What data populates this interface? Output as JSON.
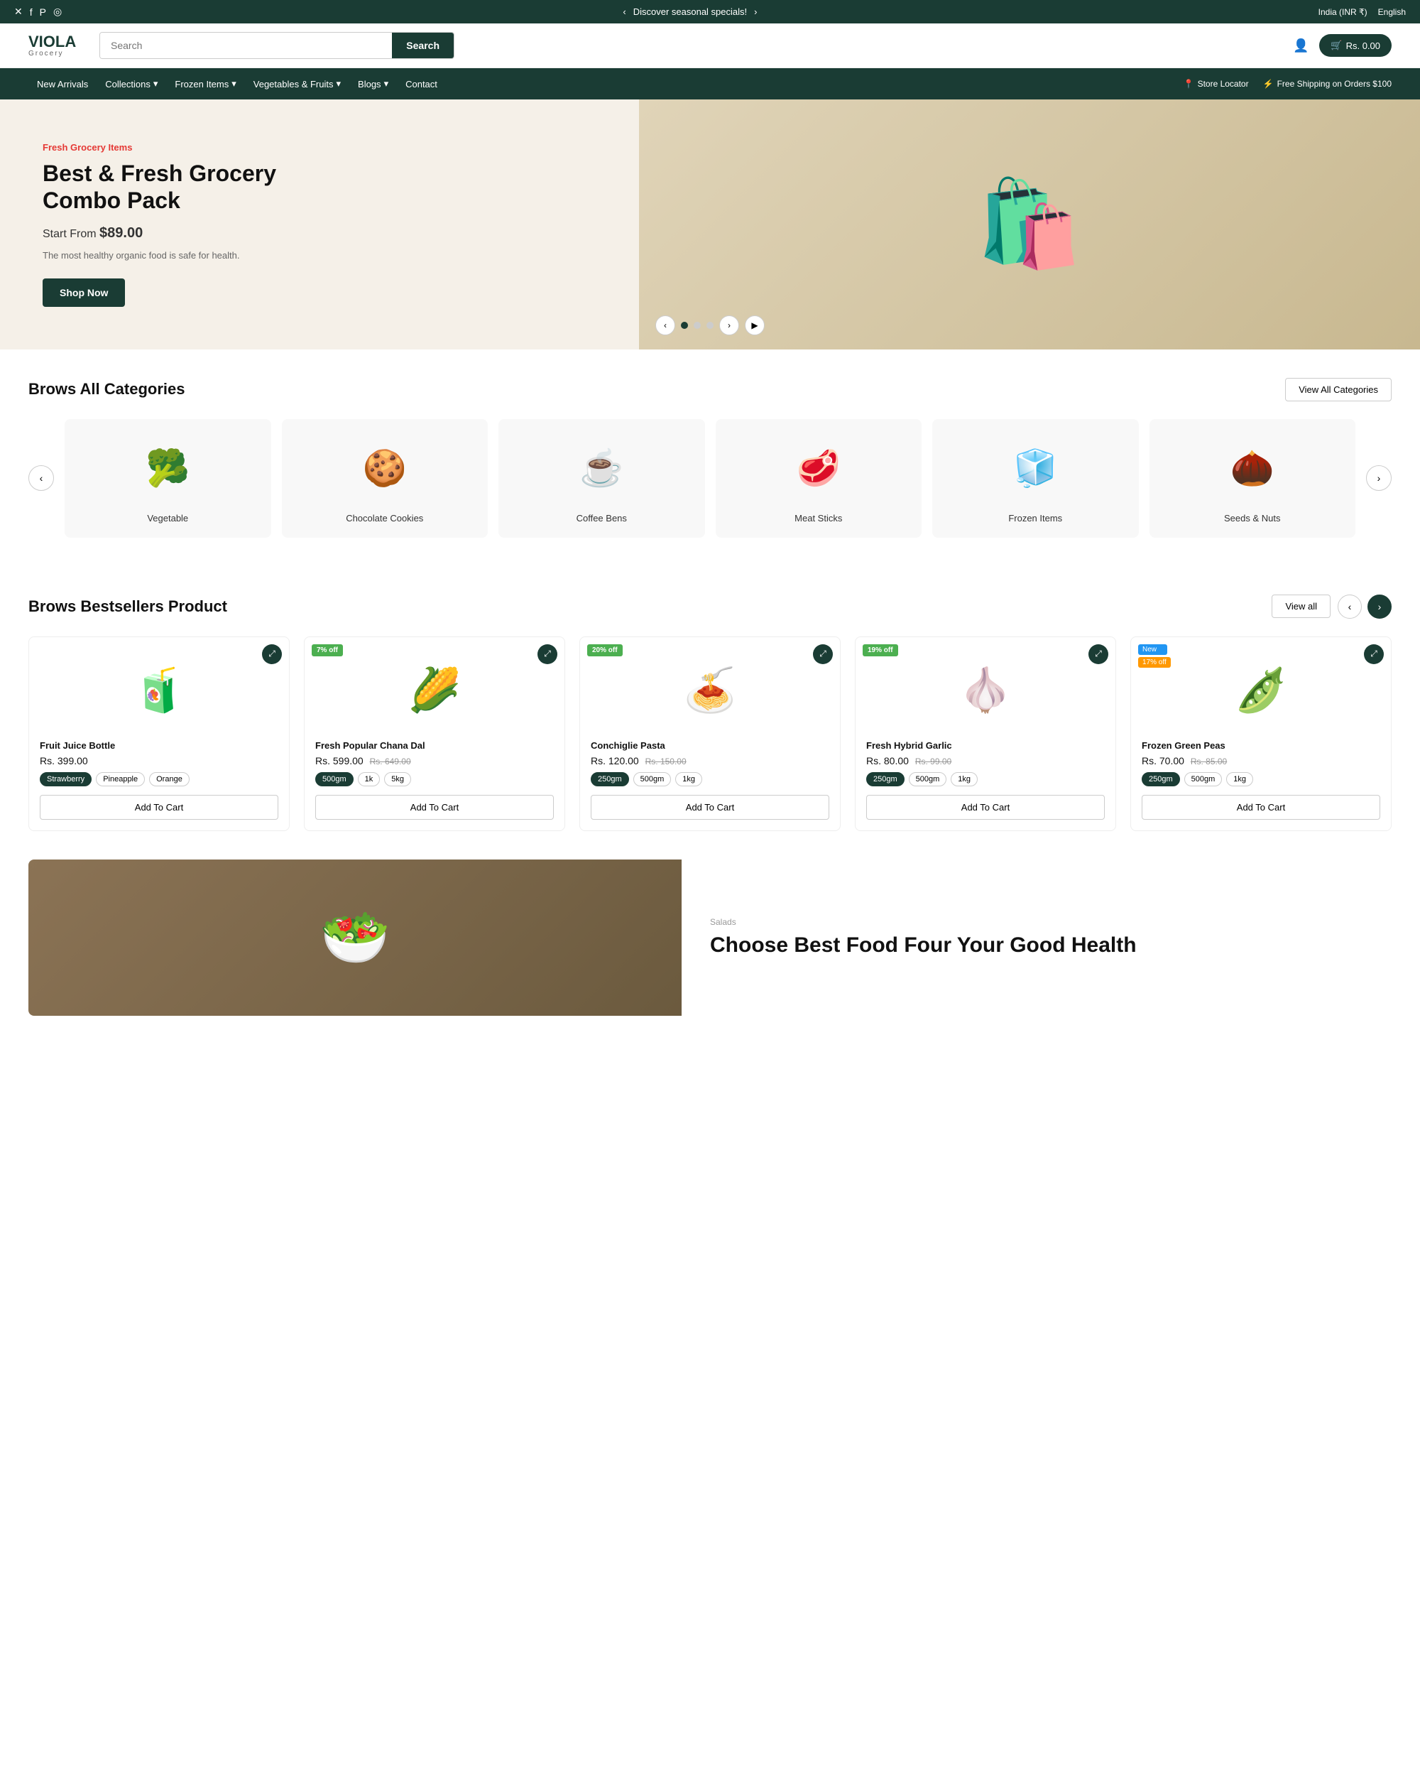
{
  "announcement": {
    "message": "Discover seasonal specials!",
    "left_arrow": "‹",
    "right_arrow": "›",
    "region": "India (INR ₹)",
    "language": "English",
    "social_icons": [
      "✕",
      "f",
      "P",
      "◎"
    ]
  },
  "header": {
    "logo_text": "VIOLA",
    "logo_sub": "Grocery",
    "search_placeholder": "Search",
    "search_button": "Search",
    "cart_label": "Rs. 0.00"
  },
  "nav": {
    "items": [
      {
        "label": "New Arrivals",
        "has_dropdown": false
      },
      {
        "label": "Collections",
        "has_dropdown": true
      },
      {
        "label": "Frozen Items",
        "has_dropdown": true
      },
      {
        "label": "Vegetables & Fruits",
        "has_dropdown": true
      },
      {
        "label": "Blogs",
        "has_dropdown": true
      },
      {
        "label": "Contact",
        "has_dropdown": false
      }
    ],
    "right_items": [
      {
        "label": "Store Locator",
        "icon": "📍"
      },
      {
        "label": "Free Shipping on Orders $100",
        "icon": "⚡"
      }
    ]
  },
  "hero": {
    "tag": "Fresh Grocery Items",
    "title": "Best & Fresh Grocery Combo Pack",
    "price_label": "Start From",
    "price": "$89.00",
    "description": "The most healthy organic food is safe for health.",
    "button_label": "Shop Now",
    "dots": [
      true,
      false,
      false
    ],
    "prev_arrow": "‹",
    "next_arrow": "›",
    "play_icon": "▶"
  },
  "categories_section": {
    "title": "Brows All Categories",
    "view_all_label": "View All Categories",
    "prev_arrow": "‹",
    "next_arrow": "›",
    "items": [
      {
        "name": "Vegetable",
        "emoji": "🥦"
      },
      {
        "name": "Chocolate Cookies",
        "emoji": "🍪"
      },
      {
        "name": "Coffee Bens",
        "emoji": "☕"
      },
      {
        "name": "Meat Sticks",
        "emoji": "🥩"
      },
      {
        "name": "Frozen Items",
        "emoji": "🧊"
      },
      {
        "name": "Seeds & Nuts",
        "emoji": "🌰"
      }
    ]
  },
  "bestsellers_section": {
    "title": "Brows Bestsellers Product",
    "view_all_label": "View all",
    "prev_arrow": "‹",
    "next_arrow": "›",
    "products": [
      {
        "name": "Fruit Juice Bottle",
        "price": "Rs. 399.00",
        "old_price": null,
        "badge": null,
        "badge_type": null,
        "emoji": "🧃",
        "variants": [
          {
            "label": "Strawberry",
            "active": true
          },
          {
            "label": "Pineapple",
            "active": false
          },
          {
            "label": "Orange",
            "active": false
          }
        ],
        "add_to_cart": "Add To Cart"
      },
      {
        "name": "Fresh Popular Chana Dal",
        "price": "Rs. 599.00",
        "old_price": "Rs. 649.00",
        "badge": "7% off",
        "badge_type": "sale",
        "emoji": "🌽",
        "variants": [
          {
            "label": "500gm",
            "active": true
          },
          {
            "label": "1k",
            "active": false
          },
          {
            "label": "5kg",
            "active": false
          }
        ],
        "add_to_cart": "Add To Cart"
      },
      {
        "name": "Conchiglie Pasta",
        "price": "Rs. 120.00",
        "old_price": "Rs. 150.00",
        "badge": "20% off",
        "badge_type": "sale",
        "emoji": "🍝",
        "variants": [
          {
            "label": "250gm",
            "active": true
          },
          {
            "label": "500gm",
            "active": false
          },
          {
            "label": "1kg",
            "active": false
          }
        ],
        "add_to_cart": "Add To Cart"
      },
      {
        "name": "Fresh Hybrid Garlic",
        "price": "Rs. 80.00",
        "old_price": "Rs. 99.00",
        "badge": "19% off",
        "badge_type": "sale",
        "emoji": "🧄",
        "variants": [
          {
            "label": "250gm",
            "active": true
          },
          {
            "label": "500gm",
            "active": false
          },
          {
            "label": "1kg",
            "active": false
          }
        ],
        "add_to_cart": "Add To Cart"
      },
      {
        "name": "Frozen Green Peas",
        "price": "Rs. 70.00",
        "old_price": "Rs. 85.00",
        "badge": "New",
        "badge2": "17% off",
        "badge_type": "new",
        "emoji": "🫛",
        "variants": [
          {
            "label": "250gm",
            "active": true
          },
          {
            "label": "500gm",
            "active": false
          },
          {
            "label": "1kg",
            "active": false
          }
        ],
        "add_to_cart": "Add To Cart"
      }
    ]
  },
  "promo_section": {
    "tag": "Salads",
    "title": "Choose Best Food Four Your Good Health"
  }
}
